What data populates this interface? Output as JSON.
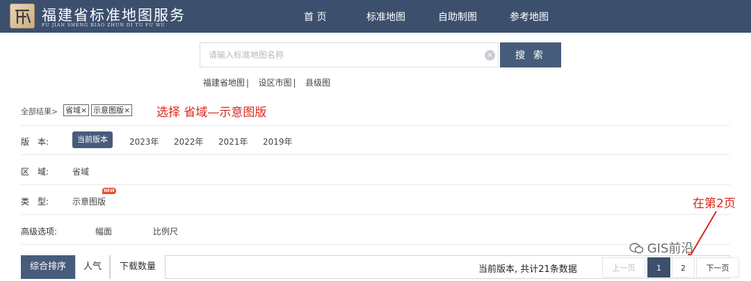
{
  "header": {
    "title": "福建省标准地图服务",
    "subtitle": "FU JIAN SHENG BIAO ZHUN DI TU FU WU",
    "nav": [
      "首 页",
      "标准地图",
      "自助制图",
      "参考地图"
    ]
  },
  "search": {
    "placeholder": "请输入标准地图名称",
    "button": "搜 索",
    "clear": "×"
  },
  "quick_links": [
    "福建省地图",
    "设区市图",
    "县级图"
  ],
  "breadcrumb": {
    "prefix": "全部结果>",
    "tags": [
      "省域×",
      "示意图版×"
    ]
  },
  "annotations": {
    "select_hint": "选择 省域—示意图版",
    "page_hint": "在第2页"
  },
  "filters": {
    "version": {
      "label": "版　本:",
      "options": [
        "当前版本",
        "2023年",
        "2022年",
        "2021年",
        "2019年"
      ]
    },
    "region": {
      "label": "区　域:",
      "options": [
        "省域"
      ]
    },
    "type": {
      "label": "类　型:",
      "options": [
        "示意图版"
      ],
      "badge": "NEW"
    },
    "advanced": {
      "label": "高级选项:",
      "options": [
        "幅面",
        "比例尺"
      ]
    }
  },
  "sort_tabs": [
    "综合排序",
    "人气",
    "下载数量"
  ],
  "summary": "当前版本, 共计21条数据",
  "pagination": {
    "prev": "上一页",
    "pages": [
      "1",
      "2"
    ],
    "next": "下一页",
    "current": "1"
  },
  "watermark": "GIS前沿",
  "colors": {
    "header": "#3c506e",
    "accent": "#475c7a",
    "annotation": "#d9261c"
  }
}
